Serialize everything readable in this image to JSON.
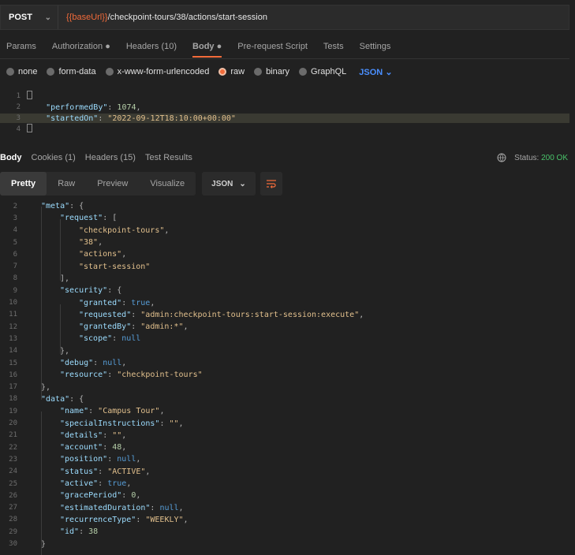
{
  "request": {
    "method": "POST",
    "url_var": "{{baseUrl}}",
    "url_path": "/checkpoint-tours/38/actions/start-session"
  },
  "req_tabs": {
    "params": "Params",
    "authorization": "Authorization",
    "headers": "Headers",
    "headers_count": "(10)",
    "body": "Body",
    "prerequest": "Pre-request Script",
    "tests": "Tests",
    "settings": "Settings",
    "dot": "●"
  },
  "body_types": {
    "none": "none",
    "form_data": "form-data",
    "urlencoded": "x-www-form-urlencoded",
    "raw": "raw",
    "binary": "binary",
    "graphql": "GraphQL",
    "format": "JSON"
  },
  "request_body": [
    {
      "ln": "1",
      "text": ""
    },
    {
      "ln": "2",
      "key": "\"performedBy\"",
      "sep": ": ",
      "num": "1074",
      "tail": ","
    },
    {
      "ln": "3",
      "key": "\"startedOn\"",
      "sep": ": ",
      "str": "\"2022-09-12T18:10:00+00:00\"",
      "tail": ""
    },
    {
      "ln": "4",
      "text": ""
    }
  ],
  "response_tabs": {
    "body": "Body",
    "cookies": "Cookies",
    "cookies_count": "(1)",
    "headers": "Headers",
    "headers_count": "(15)",
    "test_results": "Test Results",
    "status_label": "Status:",
    "status_value": "200 OK"
  },
  "format_bar": {
    "pretty": "Pretty",
    "raw": "Raw",
    "preview": "Preview",
    "visualize": "Visualize",
    "format": "JSON"
  },
  "response_lines": [
    {
      "ln": "2",
      "ind": 1,
      "parts": [
        [
          "key",
          "\"meta\""
        ],
        [
          "p",
          ": {"
        ]
      ]
    },
    {
      "ln": "3",
      "ind": 2,
      "parts": [
        [
          "key",
          "\"request\""
        ],
        [
          "p",
          ": ["
        ]
      ]
    },
    {
      "ln": "4",
      "ind": 3,
      "parts": [
        [
          "str",
          "\"checkpoint-tours\""
        ],
        [
          "p",
          ","
        ]
      ]
    },
    {
      "ln": "5",
      "ind": 3,
      "parts": [
        [
          "str",
          "\"38\""
        ],
        [
          "p",
          ","
        ]
      ]
    },
    {
      "ln": "6",
      "ind": 3,
      "parts": [
        [
          "str",
          "\"actions\""
        ],
        [
          "p",
          ","
        ]
      ]
    },
    {
      "ln": "7",
      "ind": 3,
      "parts": [
        [
          "str",
          "\"start-session\""
        ]
      ]
    },
    {
      "ln": "8",
      "ind": 2,
      "parts": [
        [
          "p",
          "],"
        ]
      ]
    },
    {
      "ln": "9",
      "ind": 2,
      "parts": [
        [
          "key",
          "\"security\""
        ],
        [
          "p",
          ": {"
        ]
      ]
    },
    {
      "ln": "10",
      "ind": 3,
      "parts": [
        [
          "key",
          "\"granted\""
        ],
        [
          "p",
          ": "
        ],
        [
          "kw",
          "true"
        ],
        [
          "p",
          ","
        ]
      ]
    },
    {
      "ln": "11",
      "ind": 3,
      "parts": [
        [
          "key",
          "\"requested\""
        ],
        [
          "p",
          ": "
        ],
        [
          "str",
          "\"admin:checkpoint-tours:start-session:execute\""
        ],
        [
          "p",
          ","
        ]
      ]
    },
    {
      "ln": "12",
      "ind": 3,
      "parts": [
        [
          "key",
          "\"grantedBy\""
        ],
        [
          "p",
          ": "
        ],
        [
          "str",
          "\"admin:*\""
        ],
        [
          "p",
          ","
        ]
      ]
    },
    {
      "ln": "13",
      "ind": 3,
      "parts": [
        [
          "key",
          "\"scope\""
        ],
        [
          "p",
          ": "
        ],
        [
          "kw",
          "null"
        ]
      ]
    },
    {
      "ln": "14",
      "ind": 2,
      "parts": [
        [
          "p",
          "},"
        ]
      ]
    },
    {
      "ln": "15",
      "ind": 2,
      "parts": [
        [
          "key",
          "\"debug\""
        ],
        [
          "p",
          ": "
        ],
        [
          "kw",
          "null"
        ],
        [
          "p",
          ","
        ]
      ]
    },
    {
      "ln": "16",
      "ind": 2,
      "parts": [
        [
          "key",
          "\"resource\""
        ],
        [
          "p",
          ": "
        ],
        [
          "str",
          "\"checkpoint-tours\""
        ]
      ]
    },
    {
      "ln": "17",
      "ind": 1,
      "parts": [
        [
          "p",
          "},"
        ]
      ]
    },
    {
      "ln": "18",
      "ind": 1,
      "parts": [
        [
          "key",
          "\"data\""
        ],
        [
          "p",
          ": {"
        ]
      ]
    },
    {
      "ln": "19",
      "ind": 2,
      "parts": [
        [
          "key",
          "\"name\""
        ],
        [
          "p",
          ": "
        ],
        [
          "str",
          "\"Campus Tour\""
        ],
        [
          "p",
          ","
        ]
      ]
    },
    {
      "ln": "20",
      "ind": 2,
      "parts": [
        [
          "key",
          "\"specialInstructions\""
        ],
        [
          "p",
          ": "
        ],
        [
          "str",
          "\"\""
        ],
        [
          "p",
          ","
        ]
      ]
    },
    {
      "ln": "21",
      "ind": 2,
      "parts": [
        [
          "key",
          "\"details\""
        ],
        [
          "p",
          ": "
        ],
        [
          "str",
          "\"\""
        ],
        [
          "p",
          ","
        ]
      ]
    },
    {
      "ln": "22",
      "ind": 2,
      "parts": [
        [
          "key",
          "\"account\""
        ],
        [
          "p",
          ": "
        ],
        [
          "num",
          "48"
        ],
        [
          "p",
          ","
        ]
      ]
    },
    {
      "ln": "23",
      "ind": 2,
      "parts": [
        [
          "key",
          "\"position\""
        ],
        [
          "p",
          ": "
        ],
        [
          "kw",
          "null"
        ],
        [
          "p",
          ","
        ]
      ]
    },
    {
      "ln": "24",
      "ind": 2,
      "parts": [
        [
          "key",
          "\"status\""
        ],
        [
          "p",
          ": "
        ],
        [
          "str",
          "\"ACTIVE\""
        ],
        [
          "p",
          ","
        ]
      ]
    },
    {
      "ln": "25",
      "ind": 2,
      "parts": [
        [
          "key",
          "\"active\""
        ],
        [
          "p",
          ": "
        ],
        [
          "kw",
          "true"
        ],
        [
          "p",
          ","
        ]
      ]
    },
    {
      "ln": "26",
      "ind": 2,
      "parts": [
        [
          "key",
          "\"gracePeriod\""
        ],
        [
          "p",
          ": "
        ],
        [
          "num",
          "0"
        ],
        [
          "p",
          ","
        ]
      ]
    },
    {
      "ln": "27",
      "ind": 2,
      "parts": [
        [
          "key",
          "\"estimatedDuration\""
        ],
        [
          "p",
          ": "
        ],
        [
          "kw",
          "null"
        ],
        [
          "p",
          ","
        ]
      ]
    },
    {
      "ln": "28",
      "ind": 2,
      "parts": [
        [
          "key",
          "\"recurrenceType\""
        ],
        [
          "p",
          ": "
        ],
        [
          "str",
          "\"WEEKLY\""
        ],
        [
          "p",
          ","
        ]
      ]
    },
    {
      "ln": "29",
      "ind": 2,
      "parts": [
        [
          "key",
          "\"id\""
        ],
        [
          "p",
          ": "
        ],
        [
          "num",
          "38"
        ]
      ]
    },
    {
      "ln": "30",
      "ind": 1,
      "parts": [
        [
          "p",
          "}"
        ]
      ]
    }
  ]
}
